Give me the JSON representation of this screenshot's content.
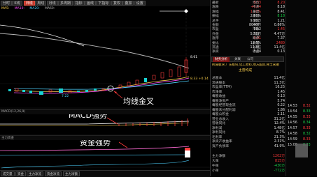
{
  "toolbar": {
    "buttons": [
      "分时",
      "K线",
      "日线",
      "周线",
      "月线",
      "多周期",
      "指标",
      "画线",
      "下指标",
      "复权",
      "叠加",
      "设置"
    ],
    "active_index": 2
  },
  "ma_legend": [
    "MA5:  ",
    "MA10:  ",
    "MA20:  ",
    "MA60:  "
  ],
  "price_labels": {
    "p1": "8.61",
    "p2": "8.33 +0.14",
    "low": "7.22"
  },
  "annotations": {
    "golden_cross": "均线金叉",
    "macd_strong": "MACD强势",
    "fund_strong": "资金强势"
  },
  "sub_panels": {
    "macd_title": "MACD(12,26,9)",
    "fund_title": "主力资金"
  },
  "bottom_tabs": [
    "成交量",
    "资金",
    "主力净流",
    "资金净流",
    "主力净额"
  ],
  "quote": {
    "rows": [
      {
        "l": "最新",
        "v": "8.33",
        "l2": "均价",
        "v2": "8.20"
      },
      {
        "l": "涨跌",
        "v": "+0.14",
        "l2": "今开",
        "v2": "8.18"
      },
      {
        "l": "涨幅",
        "v": "1.71%",
        "l2": "最高",
        "v2": "8.41"
      },
      {
        "l": "振幅",
        "v": "2.81%",
        "l2": "最低",
        "v2": "8.18"
      },
      {
        "l": "总手",
        "v": "9.78万",
        "l2": "量比",
        "v2": "1.21"
      },
      {
        "l": "金额",
        "v": "8040万",
        "l2": "换手",
        "v2": "0.86%"
      },
      {
        "l": "市盈",
        "v": "16.2",
        "l2": "市净",
        "v2": "1.45"
      },
      {
        "l": "外盘",
        "v": "5.31万",
        "l2": "内盘",
        "v2": "4.47万"
      },
      {
        "l": "涨停",
        "v": "9.01",
        "l2": "跌停",
        "v2": "7.37"
      },
      {
        "l": "委比",
        "v": "12.5%",
        "l2": "委差",
        "v2": "2480"
      },
      {
        "l": "流通",
        "v": "11.3亿",
        "l2": "总股",
        "v2": "11.4亿"
      },
      {
        "l": "净资",
        "v": "5.74",
        "l2": "收益",
        "v2": "0.13"
      }
    ],
    "tabs": [
      "财务分析",
      "关联",
      "公司"
    ],
    "tab_active": 0,
    "concept": "所属板块 广东板块,化工原料,地方国资,稀土永磁",
    "main_biz_label": "主营构成",
    "fin_rows": [
      {
        "l": "总股本",
        "v": "11.4亿"
      },
      {
        "l": "流通股本",
        "v": "11.3亿"
      },
      {
        "l": "市盈率(TTM)",
        "v": "16.25"
      },
      {
        "l": "市净率",
        "v": "1.45"
      },
      {
        "l": "每股收益",
        "v": "0.13"
      },
      {
        "l": "每股净资产",
        "v": "5.74"
      },
      {
        "l": "每股经营现金流",
        "v": "0.22"
      },
      {
        "l": "每股未分配利润",
        "v": "1.86"
      },
      {
        "l": "每股公积金",
        "v": "2.11"
      },
      {
        "l": "营业总收入",
        "v": "31.2亿"
      },
      {
        "l": "营收同比",
        "v": "12.4%"
      },
      {
        "l": "净利润",
        "v": "1.48亿"
      },
      {
        "l": "净利同比",
        "v": "8.7%"
      },
      {
        "l": "毛利率",
        "v": "21.3%"
      },
      {
        "l": "净资产收益率",
        "v": "2.31%"
      },
      {
        "l": "资产负债率",
        "v": "41.9%"
      }
    ],
    "bottom_rows": [
      {
        "l": "主力净额",
        "v": "1202万"
      },
      {
        "l": "大单",
        "v": "815万"
      },
      {
        "l": "中单",
        "v": "-430万"
      },
      {
        "l": "小单",
        "v": "-772万"
      }
    ]
  },
  "side_strip": {
    "times": [
      "14:53",
      "14:54",
      "14:55",
      "14:56",
      "14:57",
      "14:58",
      "14:59",
      "15:00"
    ],
    "cells": [
      "8.32",
      "8.33",
      "8.33",
      "8.34",
      "8.33",
      "8.32",
      "8.33",
      "8.33"
    ]
  }
}
